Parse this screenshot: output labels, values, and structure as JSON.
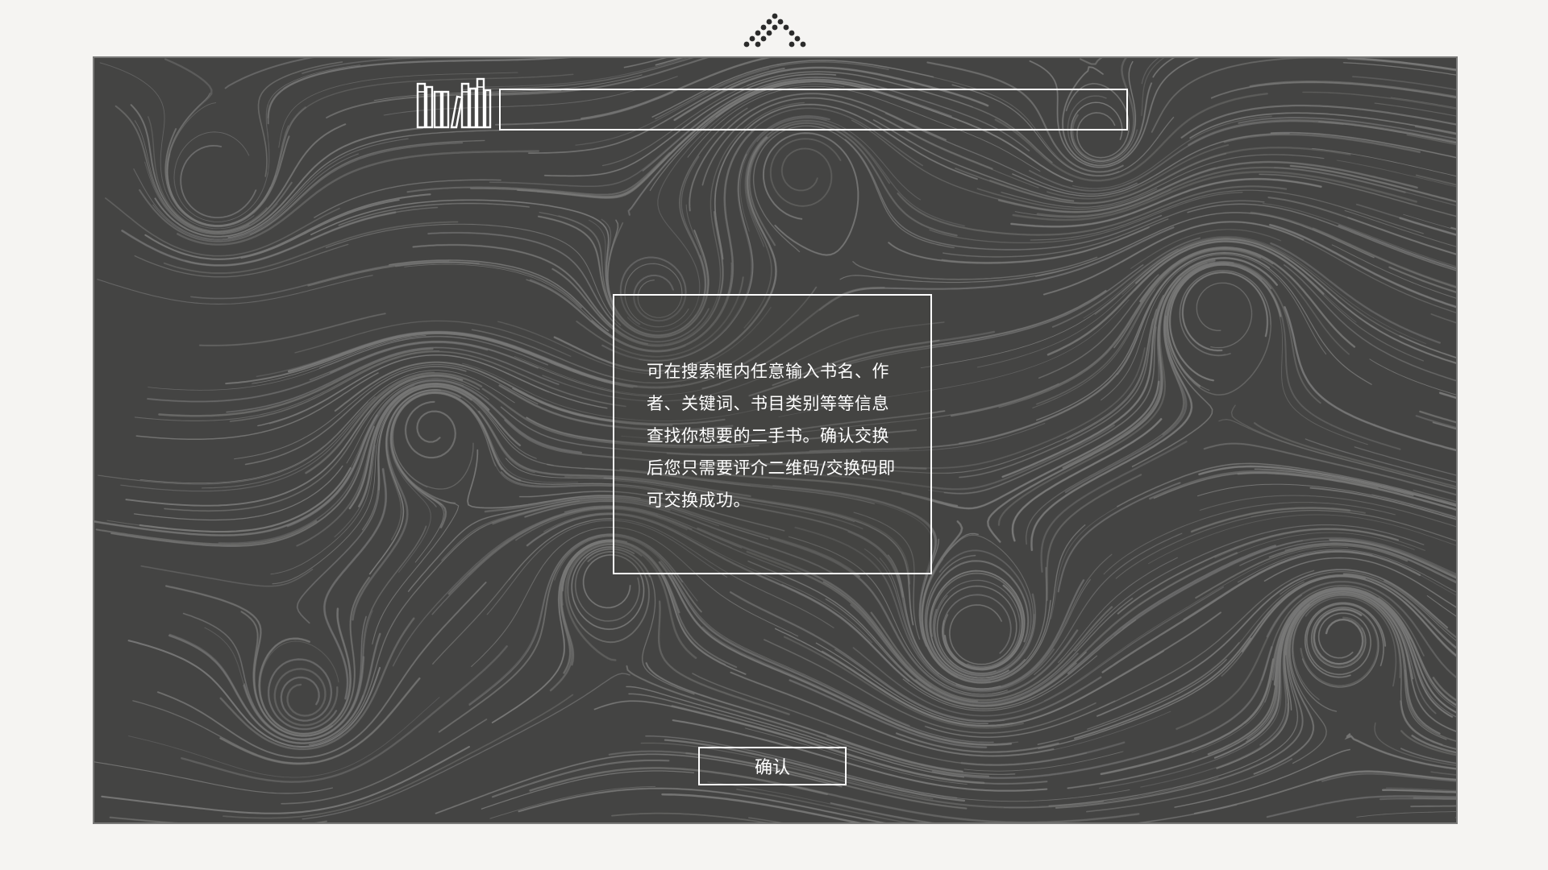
{
  "logo": {
    "icon": "dot-triangle-logo-icon"
  },
  "search": {
    "icon": "books-icon",
    "value": "",
    "placeholder": ""
  },
  "info_card": {
    "text": "可在搜索框内任意输入书名、作者、关键词、书目类别等等信息查找你想要的二手书。确认交换后您只需要评介二维码/交换码即可交换成功。"
  },
  "confirm_button": {
    "label": "确认"
  },
  "colors": {
    "page_background": "#f5f4f2",
    "stage_background": "#444443",
    "texture_lines": "#7e7e7d",
    "foreground": "#ffffff"
  }
}
